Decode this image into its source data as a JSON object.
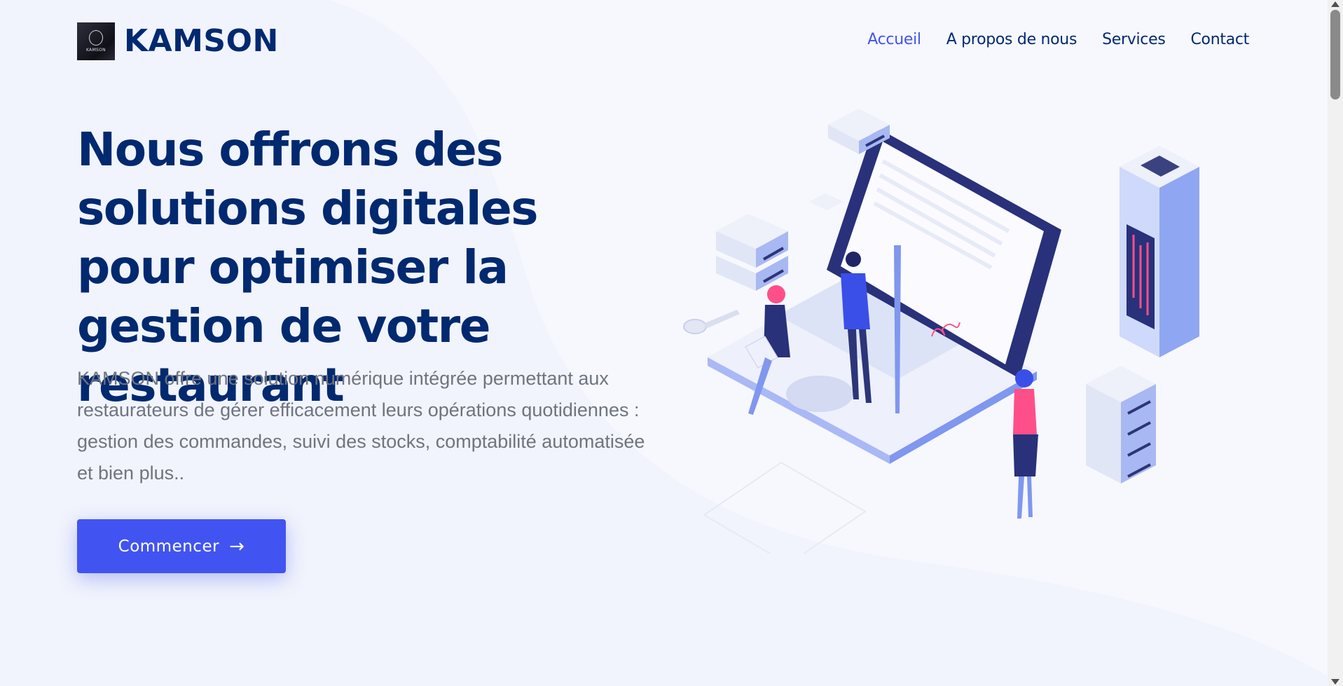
{
  "header": {
    "logo_mini_text": "KAMSON",
    "brand": "KAMSON",
    "nav": [
      {
        "label": "Accueil",
        "active": true
      },
      {
        "label": "A propos de nous",
        "active": false
      },
      {
        "label": "Services",
        "active": false
      },
      {
        "label": "Contact",
        "active": false
      }
    ]
  },
  "hero": {
    "title": "Nous offrons des solutions digitales pour optimiser la gestion de votre restaurant",
    "subtitle": "KAMSON offre une solution numérique intégrée permettant aux restaurateurs de gérer efficacement leurs opérations quotidiennes : gestion des commandes, suivi des stocks, comptabilité automatisée et bien plus..",
    "cta_label": "Commencer",
    "cta_icon": "arrow-right-icon"
  },
  "colors": {
    "primary": "#4154f1",
    "navy": "#012970",
    "text_muted": "#6f7480",
    "background": "#f1f4fc"
  }
}
